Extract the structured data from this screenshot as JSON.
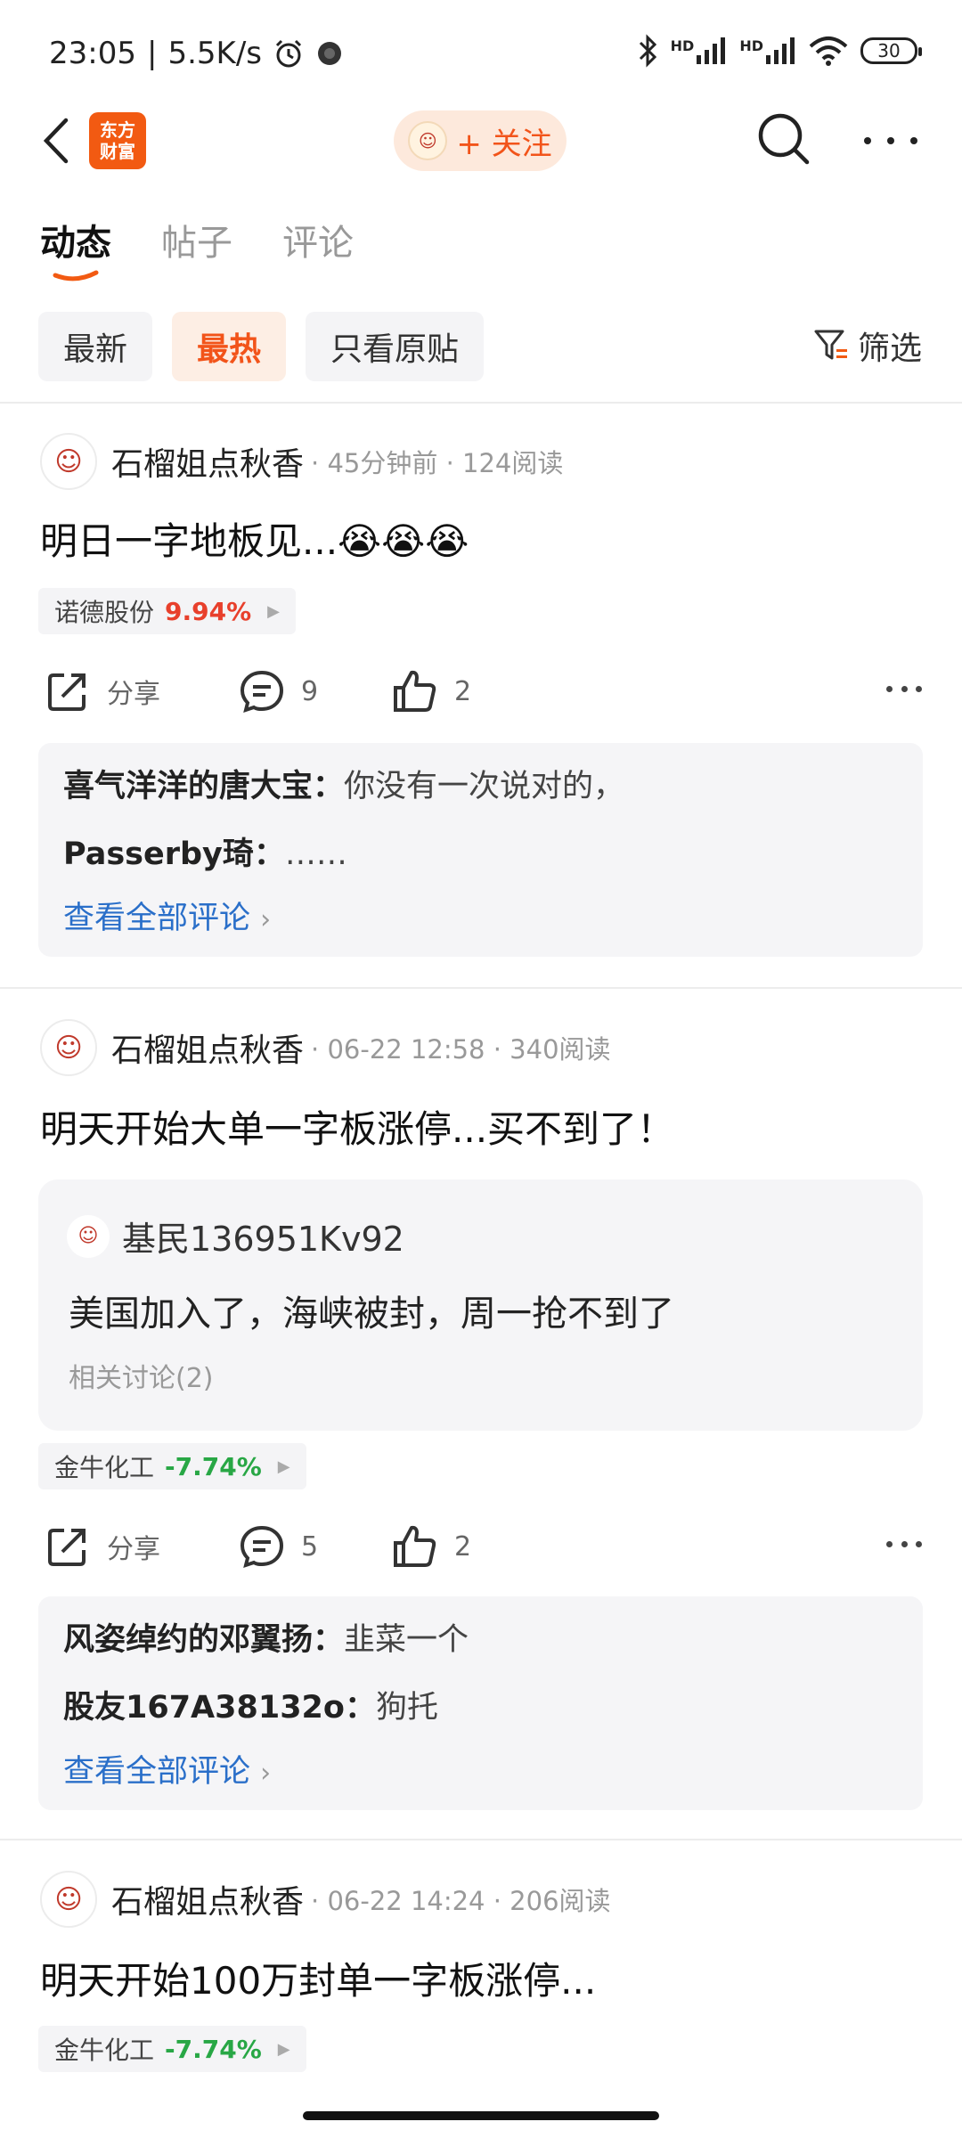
{
  "status_bar": {
    "time": "23:05",
    "net_speed": "5.5K/s",
    "battery": "30",
    "signal_label_1": "HD",
    "signal_label_2": "HD"
  },
  "header": {
    "logo_line1": "东方",
    "logo_line2": "财富",
    "follow_label": "+ 关注",
    "brand_color": "#f25a12"
  },
  "tabs": [
    {
      "label": "动态",
      "active": true
    },
    {
      "label": "帖子",
      "active": false
    },
    {
      "label": "评论",
      "active": false
    }
  ],
  "filters": {
    "chips": [
      {
        "label": "最新",
        "active": false
      },
      {
        "label": "最热",
        "active": true
      },
      {
        "label": "只看原贴",
        "active": false
      }
    ],
    "filter_label": "筛选"
  },
  "posts": [
    {
      "author": "石榴姐点秋香",
      "meta": "· 45分钟前 · 124阅读",
      "title": "明日一字地板见...😭😭😭",
      "stock": {
        "name": "诺德股份",
        "change": "9.94%"
      },
      "share_label": "分享",
      "comment_count": "9",
      "like_count": "2",
      "comments": [
        {
          "user": "喜气洋洋的唐大宝：",
          "text": "你没有一次说对的，"
        },
        {
          "user": "Passerby琦：",
          "text": "……"
        }
      ],
      "view_all": "查看全部评论"
    },
    {
      "author": "石榴姐点秋香",
      "meta": "· 06-22 12:58 · 340阅读",
      "title": "明天开始大单一字板涨停...买不到了！",
      "quote": {
        "user": "基民136951Kv92",
        "text": "美国加入了，海峡被封，周一抢不到了",
        "related": "相关讨论(2)"
      },
      "stock": {
        "name": "金牛化工",
        "change": "-7.74%"
      },
      "share_label": "分享",
      "comment_count": "5",
      "like_count": "2",
      "comments": [
        {
          "user": "风姿绰约的邓翼扬：",
          "text": "韭菜一个"
        },
        {
          "user": "股友167A38132o：",
          "text": "狗托"
        }
      ],
      "view_all": "查看全部评论"
    },
    {
      "author": "石榴姐点秋香",
      "meta": "· 06-22 14:24 · 206阅读",
      "title": "明天开始100万封单一字板涨停...",
      "stock": {
        "name": "金牛化工",
        "change": "-7.74%"
      }
    }
  ],
  "colors": {
    "accent": "#f2541a",
    "up": "#e8402c",
    "down": "#28a745",
    "link": "#2a6fc9"
  }
}
